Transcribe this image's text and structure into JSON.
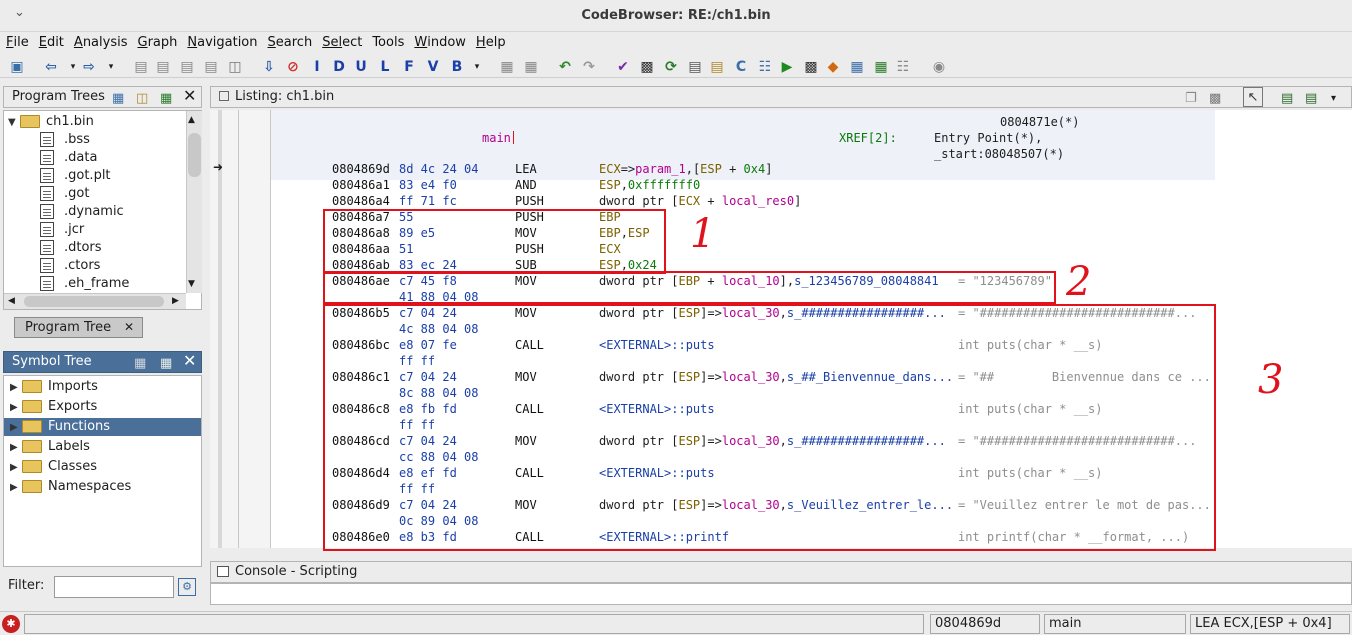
{
  "window": {
    "title": "CodeBrowser: RE:/ch1.bin"
  },
  "menu": [
    {
      "u": "F",
      "r": "ile"
    },
    {
      "u": "E",
      "r": "dit"
    },
    {
      "u": "A",
      "r": "nalysis"
    },
    {
      "u": "G",
      "r": "raph"
    },
    {
      "u": "N",
      "r": "avigation"
    },
    {
      "u": "S",
      "r": "earch"
    },
    {
      "u": "Sel",
      "r": "ect"
    },
    {
      "u": "",
      "r": "Tools"
    },
    {
      "u": "W",
      "r": "indow"
    },
    {
      "u": "H",
      "r": "elp"
    }
  ],
  "program_trees": {
    "title": "Program Trees",
    "root": "ch1.bin",
    "items": [
      ".bss",
      ".data",
      ".got.plt",
      ".got",
      ".dynamic",
      ".jcr",
      ".dtors",
      ".ctors",
      ".eh_frame"
    ],
    "tab_label": "Program Tree"
  },
  "symbol_tree": {
    "title": "Symbol Tree",
    "items": [
      "Imports",
      "Exports",
      "Functions",
      "Labels",
      "Classes",
      "Namespaces"
    ],
    "selected": "Functions"
  },
  "filter": {
    "label": "Filter:",
    "value": ""
  },
  "listing": {
    "title": "Listing:  ch1.bin",
    "header": {
      "func": "main",
      "xref_label": "XREF[2]:",
      "xref1": "0804871e(*)",
      "xref2": "Entry Point(*),",
      "xref3": "_start:08048507(*)"
    },
    "rows": [
      {
        "addr": "0804869d",
        "bytes": "8d 4c 24 04",
        "mn": "LEA",
        "op": "ECX=>param_1,[ESP + 0x4]",
        "cmt": ""
      },
      {
        "addr": "080486a1",
        "bytes": "83 e4 f0",
        "mn": "AND",
        "op": "ESP,0xfffffff0",
        "cmt": ""
      },
      {
        "addr": "080486a4",
        "bytes": "ff 71 fc",
        "mn": "PUSH",
        "op": "dword ptr [ECX + local_res0]",
        "cmt": ""
      },
      {
        "addr": "080486a7",
        "bytes": "55",
        "mn": "PUSH",
        "op": "EBP",
        "cmt": ""
      },
      {
        "addr": "080486a8",
        "bytes": "89 e5",
        "mn": "MOV",
        "op": "EBP,ESP",
        "cmt": ""
      },
      {
        "addr": "080486aa",
        "bytes": "51",
        "mn": "PUSH",
        "op": "ECX",
        "cmt": ""
      },
      {
        "addr": "080486ab",
        "bytes": "83 ec 24",
        "mn": "SUB",
        "op": "ESP,0x24",
        "cmt": ""
      },
      {
        "addr": "080486ae",
        "bytes": "c7 45 f8",
        "mn": "MOV",
        "op": "dword ptr [EBP + local_10],s_123456789_08048841",
        "cmt": "= \"123456789\""
      },
      {
        "addr": "",
        "bytes": "41 88 04 08",
        "mn": "",
        "op": "",
        "cmt": ""
      },
      {
        "addr": "080486b5",
        "bytes": "c7 04 24",
        "mn": "MOV",
        "op": "dword ptr [ESP]=>local_30,s_#################...",
        "cmt": "= \"###########################..."
      },
      {
        "addr": "",
        "bytes": "4c 88 04 08",
        "mn": "",
        "op": "",
        "cmt": ""
      },
      {
        "addr": "080486bc",
        "bytes": "e8 07 fe",
        "mn": "CALL",
        "op": "<EXTERNAL>::puts",
        "cmt": "int puts(char * __s)"
      },
      {
        "addr": "",
        "bytes": "ff ff",
        "mn": "",
        "op": "",
        "cmt": ""
      },
      {
        "addr": "080486c1",
        "bytes": "c7 04 24",
        "mn": "MOV",
        "op": "dword ptr [ESP]=>local_30,s_##_Bienvennue_dans...",
        "cmt": "= \"##        Bienvennue dans ce ..."
      },
      {
        "addr": "",
        "bytes": "8c 88 04 08",
        "mn": "",
        "op": "",
        "cmt": ""
      },
      {
        "addr": "080486c8",
        "bytes": "e8 fb fd",
        "mn": "CALL",
        "op": "<EXTERNAL>::puts",
        "cmt": "int puts(char * __s)"
      },
      {
        "addr": "",
        "bytes": "ff ff",
        "mn": "",
        "op": "",
        "cmt": ""
      },
      {
        "addr": "080486cd",
        "bytes": "c7 04 24",
        "mn": "MOV",
        "op": "dword ptr [ESP]=>local_30,s_#################...",
        "cmt": "= \"###########################..."
      },
      {
        "addr": "",
        "bytes": "cc 88 04 08",
        "mn": "",
        "op": "",
        "cmt": ""
      },
      {
        "addr": "080486d4",
        "bytes": "e8 ef fd",
        "mn": "CALL",
        "op": "<EXTERNAL>::puts",
        "cmt": "int puts(char * __s)"
      },
      {
        "addr": "",
        "bytes": "ff ff",
        "mn": "",
        "op": "",
        "cmt": ""
      },
      {
        "addr": "080486d9",
        "bytes": "c7 04 24",
        "mn": "MOV",
        "op": "dword ptr [ESP]=>local_30,s_Veuillez_entrer_le...",
        "cmt": "= \"Veuillez entrer le mot de pas..."
      },
      {
        "addr": "",
        "bytes": "0c 89 04 08",
        "mn": "",
        "op": "",
        "cmt": ""
      },
      {
        "addr": "080486e0",
        "bytes": "e8 b3 fd",
        "mn": "CALL",
        "op": "<EXTERNAL>::printf",
        "cmt": "int printf(char * __format, ...)"
      }
    ]
  },
  "annotations": [
    "1",
    "2",
    "3"
  ],
  "console": {
    "title": "Console - Scripting"
  },
  "status": {
    "address": "0804869d",
    "function": "main",
    "instruction": "LEA ECX,[ESP + 0x4]"
  }
}
